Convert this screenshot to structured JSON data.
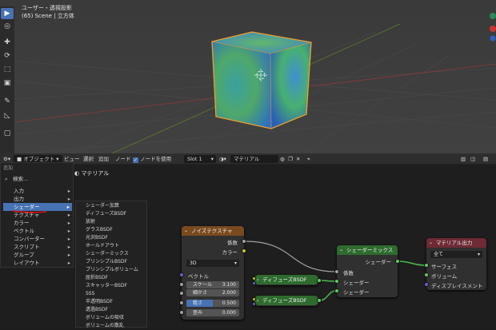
{
  "viewport": {
    "view_name": "ユーザー・透視投影",
    "scene_info": "(65) Scene | 立方体"
  },
  "header": {
    "mode": "オブジェクト",
    "menu": [
      "ビュー",
      "選択",
      "追加",
      "ノード"
    ],
    "use_nodes_label": "ノードを使用",
    "slot": "Slot 1",
    "material": "マテリアル"
  },
  "editor": {
    "material_label": "マテリアル"
  },
  "add_menu": {
    "title": "追加",
    "search_placeholder": "検索...",
    "items": [
      "入力",
      "出力",
      "シェーダー",
      "テクスチャ",
      "カラー",
      "ベクトル",
      "コンバーター",
      "スクリプト",
      "グループ",
      "レイアウト"
    ],
    "selected": "シェーダー"
  },
  "shader_submenu": {
    "items": [
      "シェーダー加算",
      "ディフューズBSDF",
      "放射",
      "グラスBSDF",
      "光沢BSDF",
      "ホールドアウト",
      "シェーダーミックス",
      "プリンシプルBSDF",
      "プリンシプルボリューム",
      "屈折BSDF",
      "スキャッターBSDF",
      "SSS",
      "半透明BSDF",
      "透過BSDF",
      "ボリュームの吸収",
      "ボリュームの散乱"
    ]
  },
  "nodes": {
    "noise": {
      "title": "ノイズテクスチャ",
      "out_fac": "係数",
      "out_color": "カラー",
      "dimension": "3D",
      "in_vector": "ベクトル",
      "scale_label": "スケール",
      "scale_value": "3.100",
      "detail_label": "細かさ",
      "detail_value": "2.000",
      "rough_label": "粗さ",
      "rough_value": "0.500",
      "distort_label": "歪み",
      "distort_value": "0.000",
      "rough_fill": 0.5
    },
    "diffuse1": {
      "title": "ディフューズBSDF"
    },
    "diffuse2": {
      "title": "ディフューズBSDF"
    },
    "mix": {
      "title": "シェーダーミックス",
      "out_shader": "シェーダー",
      "in_fac": "係数",
      "in_shader1": "シェーダー",
      "in_shader2": "シェーダー"
    },
    "output": {
      "title": "マテリアル出力",
      "target": "全て",
      "surface": "サーフェス",
      "volume": "ボリューム",
      "displacement": "ディスプレイスメント"
    }
  },
  "colors": {
    "noise_header": "#7a4a1f",
    "shader_header": "#2e6b2e",
    "output_header": "#6e2a35",
    "selection": "#4772b3",
    "socket_gray": "#a1a1a1",
    "socket_yellow": "#c7c729",
    "socket_green": "#63c763",
    "socket_purple": "#6363c7"
  }
}
